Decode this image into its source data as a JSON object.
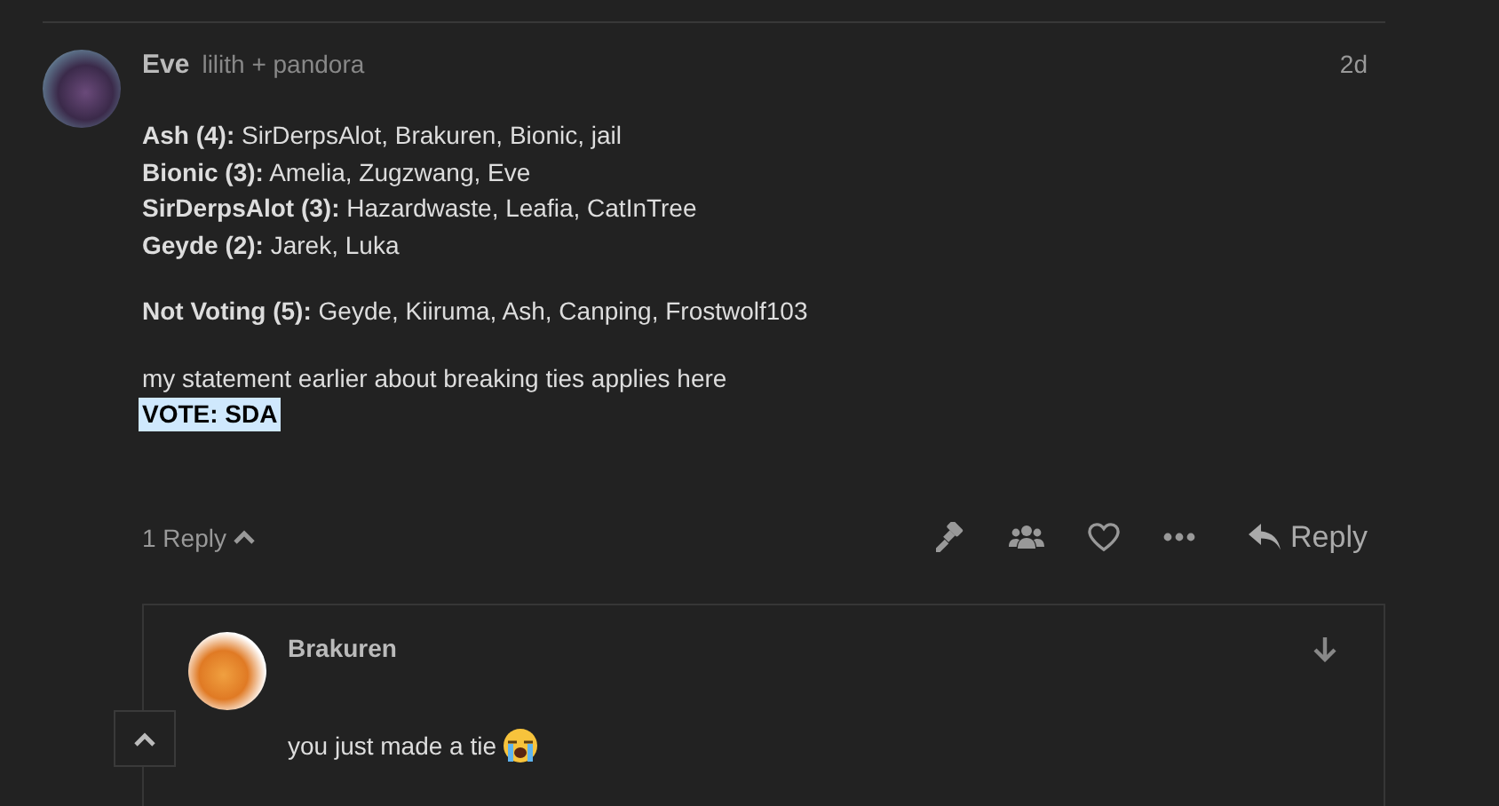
{
  "post": {
    "author": "Eve",
    "user_title": "lilith + pandora",
    "time": "2d",
    "tally": [
      "**Ash (4):** SirDerpsAlot, Brakuren, Bionic, jail",
      "**Bionic (3):** Amelia, Zugzwang, Eve",
      "**SirDerpsAlot (3):** Hazardwaste, Leafia, CatInTree",
      "**Geyde (2):** Jarek, Luka"
    ],
    "not_voting": "**Not Voting (5):** Geyde, Kiiruma, Ash, Canping, Frostwolf103",
    "statement": "my statement earlier about breaking ties applies here",
    "vote": "VOTE: SDA",
    "replies_toggle": {
      "label": "1 Reply",
      "expanded": true
    },
    "reply_button": "Reply"
  },
  "reply": {
    "author": "Brakuren",
    "text": "you just made a tie"
  }
}
